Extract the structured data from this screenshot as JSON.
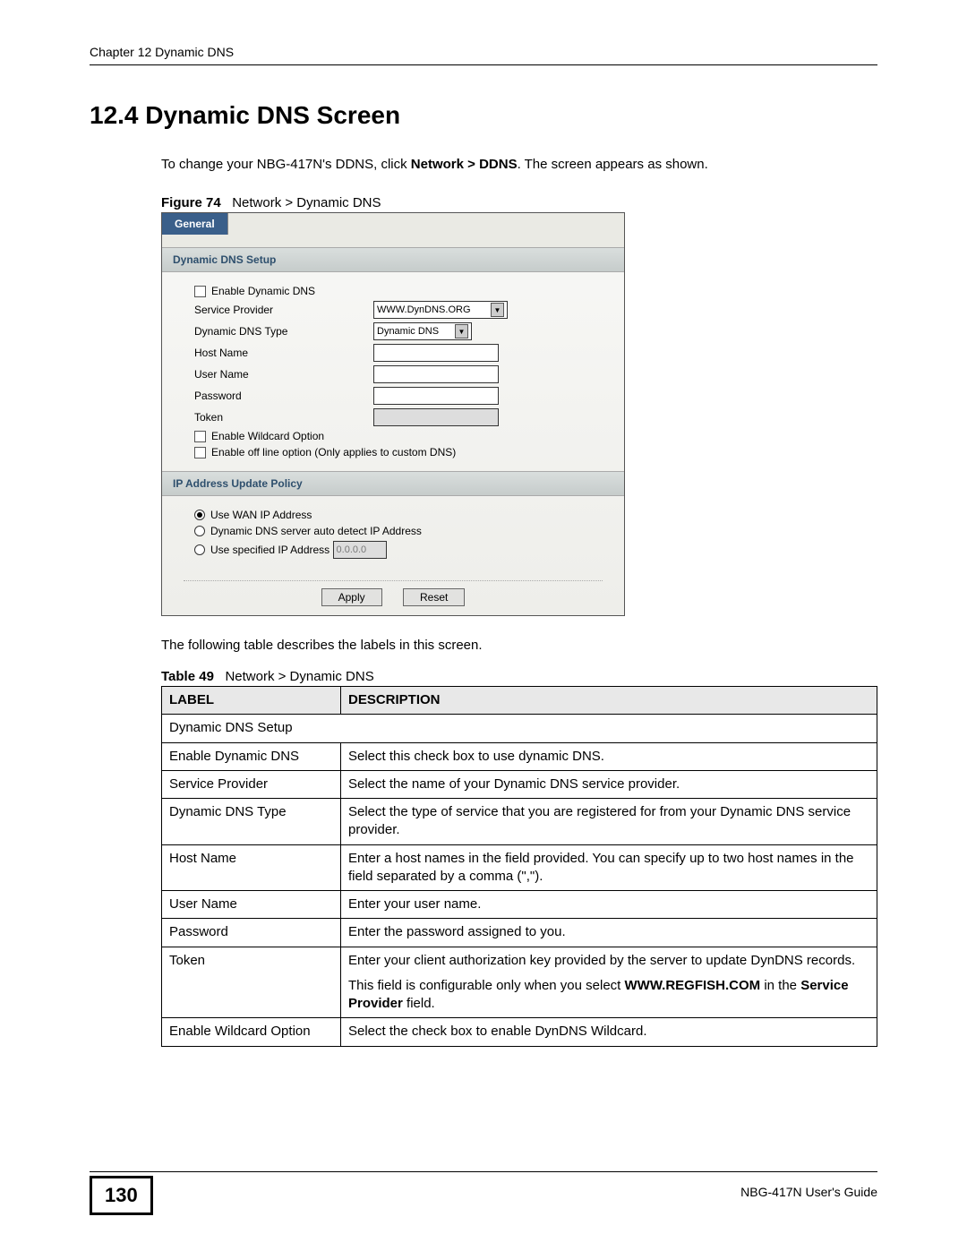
{
  "header": {
    "chapter": "Chapter 12 Dynamic DNS"
  },
  "section": {
    "number_title": "12.4  Dynamic DNS Screen",
    "intro_pre": "To change your NBG-417N's DDNS, click ",
    "intro_bold": "Network > DDNS",
    "intro_post": ". The screen appears as shown."
  },
  "figure": {
    "label": "Figure 74",
    "caption": "Network > Dynamic DNS",
    "tab": "General",
    "sec1": "Dynamic DNS Setup",
    "enable_dns": "Enable Dynamic DNS",
    "service_provider_label": "Service Provider",
    "service_provider_value": "WWW.DynDNS.ORG",
    "dns_type_label": "Dynamic DNS Type",
    "dns_type_value": "Dynamic DNS",
    "host_name": "Host Name",
    "user_name": "User Name",
    "password": "Password",
    "token": "Token",
    "wildcard": "Enable Wildcard Option",
    "offline": "Enable off line option (Only applies to custom DNS)",
    "sec2": "IP Address Update Policy",
    "use_wan": "Use WAN IP Address",
    "auto_detect": "Dynamic DNS server auto detect IP Address",
    "use_specified": "Use specified IP Address",
    "specified_ip": "0.0.0.0",
    "apply": "Apply",
    "reset": "Reset"
  },
  "mid_para": "The following table describes the labels in this screen.",
  "table": {
    "label": "Table 49",
    "caption": "Network > Dynamic DNS",
    "h1": "LABEL",
    "h2": "DESCRIPTION",
    "rows": [
      {
        "label": "Dynamic DNS Setup",
        "desc": "",
        "span": true
      },
      {
        "label": "Enable Dynamic DNS",
        "desc": "Select this check box to use dynamic DNS."
      },
      {
        "label": "Service Provider",
        "desc": "Select the name of your Dynamic DNS service provider."
      },
      {
        "label": "Dynamic DNS Type",
        "desc": "Select the type of service that you are registered for from your Dynamic DNS service provider."
      },
      {
        "label": "Host Name",
        "desc": "Enter a host names in the field provided. You can specify up to two host names in the field separated by a comma (\",\")."
      },
      {
        "label": "User Name",
        "desc": "Enter your user name."
      },
      {
        "label": "Password",
        "desc": "Enter the password assigned to you."
      },
      {
        "label": "Token",
        "desc_parts": {
          "p1": "Enter your client authorization key provided by the server to update DynDNS records.",
          "p2a": "This field is configurable only when you select ",
          "p2b": "WWW.REGFISH.COM",
          "p2c": " in the ",
          "p2d": "Service Provider",
          "p2e": " field."
        }
      },
      {
        "label": "Enable Wildcard Option",
        "desc": "Select the check box to enable DynDNS Wildcard."
      }
    ]
  },
  "footer": {
    "page": "130",
    "guide": "NBG-417N User's Guide"
  }
}
